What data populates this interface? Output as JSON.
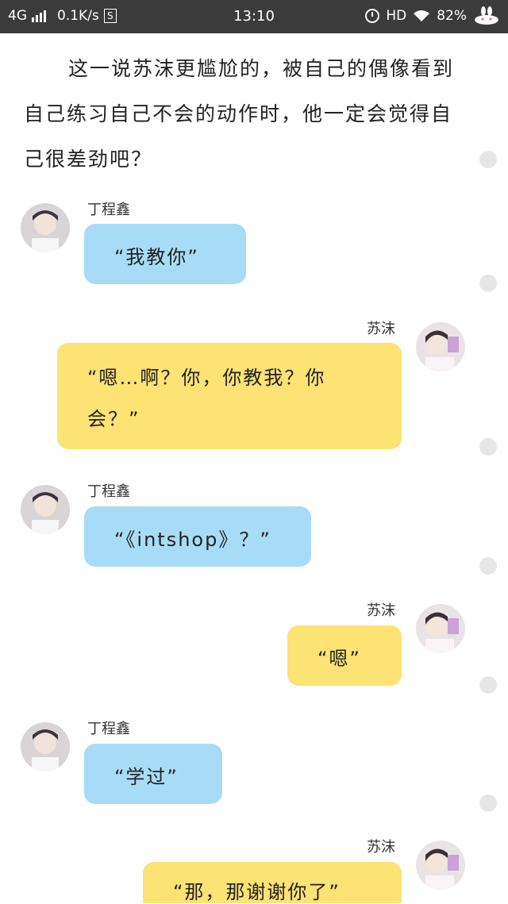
{
  "status_bar": {
    "network": "4G",
    "speed": "0.1K/s",
    "s_badge": "S",
    "time": "13:10",
    "hd": "HD",
    "battery": "82%"
  },
  "story": {
    "paragraph": "这一说苏沫更尴尬的，被自己的偶像看到自己练习自己不会的动作时，他一定会觉得自己很差劲吧？"
  },
  "chat": [
    {
      "speaker": "丁程鑫",
      "text": "“我教你”"
    },
    {
      "speaker": "苏沫",
      "text": "“嗯…啊？你，你教我？你会？”"
    },
    {
      "speaker": "丁程鑫",
      "text": "“《intshop》？”"
    },
    {
      "speaker": "苏沫",
      "text": "“嗯”"
    },
    {
      "speaker": "丁程鑫",
      "text": "“学过”"
    },
    {
      "speaker": "苏沫",
      "text": "“那，那谢谢你了”"
    }
  ],
  "colors": {
    "status_bar": "#3b3b3b",
    "left_bubble": "#a8dcf6",
    "right_bubble": "#fde274",
    "scroll_dot": "#e6e6e6"
  },
  "icons": [
    "signal-icon",
    "s-badge-icon",
    "alarm-icon",
    "wifi-icon",
    "bunny-icon",
    "avatar"
  ]
}
